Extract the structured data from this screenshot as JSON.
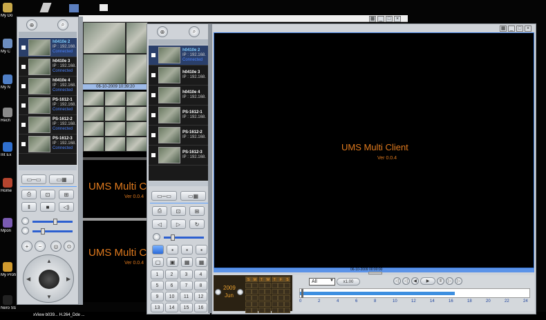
{
  "desktop": {
    "icons": [
      {
        "label": "My Do",
        "icon": "documents-icon"
      },
      {
        "label": "My C",
        "icon": "computer-icon"
      },
      {
        "label": "My N",
        "icon": "network-icon"
      },
      {
        "label": "Rech",
        "icon": "recycle-icon"
      },
      {
        "label": "Int Ex",
        "icon": "internet-icon"
      },
      {
        "label": "Home",
        "icon": "home-icon"
      },
      {
        "label": "Mpon",
        "icon": "program-icon"
      },
      {
        "label": "My Profi",
        "icon": "profile-icon"
      },
      {
        "label": "Nero StartSmart",
        "icon": "nero-icon"
      }
    ],
    "taskbar_label": "xView b039... H.264_Dde ..."
  },
  "left_panel": {
    "cameras": [
      {
        "name": "h0410e 2",
        "ip": "IP : 192.168.",
        "status": "Connected",
        "selected": true
      },
      {
        "name": "h0410e 3",
        "ip": "IP : 192.168.",
        "status": "Connected",
        "selected": false
      },
      {
        "name": "h0410e 4",
        "ip": "IP : 192.168.",
        "status": "Connected",
        "selected": false
      },
      {
        "name": "PS-1612-1",
        "ip": "IP : 192.168.",
        "status": "Connected",
        "selected": false
      },
      {
        "name": "PS-1612-2",
        "ip": "IP : 192.168.",
        "status": "Connected",
        "selected": false
      },
      {
        "name": "PS-1612-3",
        "ip": "IP : 192.168.",
        "status": "Connected",
        "selected": false
      }
    ]
  },
  "middle_view": {
    "timestamp": "06-10-2009 10:39:20",
    "ums_title": "UMS Multi Clie",
    "ums_version": "Ver 0.0.4"
  },
  "second_panel": {
    "cameras": [
      {
        "name": "h0410e 2",
        "ip": "IP : 192.168.",
        "status": "Connected",
        "selected": true
      },
      {
        "name": "h0410e 3",
        "ip": "IP : 192.168.",
        "status": "",
        "selected": false
      },
      {
        "name": "h0410e 4",
        "ip": "IP : 192.168.",
        "status": "",
        "selected": false
      },
      {
        "name": "PS-1612-1",
        "ip": "IP : 192.168.",
        "status": "",
        "selected": false
      },
      {
        "name": "PS-1612-2",
        "ip": "IP : 192.168.",
        "status": "",
        "selected": false
      },
      {
        "name": "PS-1612-3",
        "ip": "IP : 192.168.",
        "status": "",
        "selected": false
      }
    ],
    "keypad": [
      "1",
      "2",
      "3",
      "4",
      "5",
      "6",
      "7",
      "8",
      "9",
      "10",
      "11",
      "12",
      "13",
      "14",
      "15",
      "16"
    ]
  },
  "main_view": {
    "ums_title": "UMS Multi Client",
    "ums_version": "Ver 0.0.4",
    "timestamp": "06-10-2009 00:00:00"
  },
  "playback": {
    "year": "2009",
    "month": "Jun",
    "weekdays": [
      "S",
      "M",
      "T",
      "W",
      "T",
      "F",
      "S"
    ],
    "select_value": "All",
    "speed_label": "x1.00",
    "timeline_ticks": [
      "0",
      "2",
      "4",
      "6",
      "8",
      "10",
      "12",
      "14",
      "16",
      "18",
      "20",
      "22",
      "24"
    ]
  },
  "colors": {
    "accent_orange": "#e07a1e",
    "status_blue": "#4e84ff",
    "timeline_blue": "#3d8fe0"
  }
}
